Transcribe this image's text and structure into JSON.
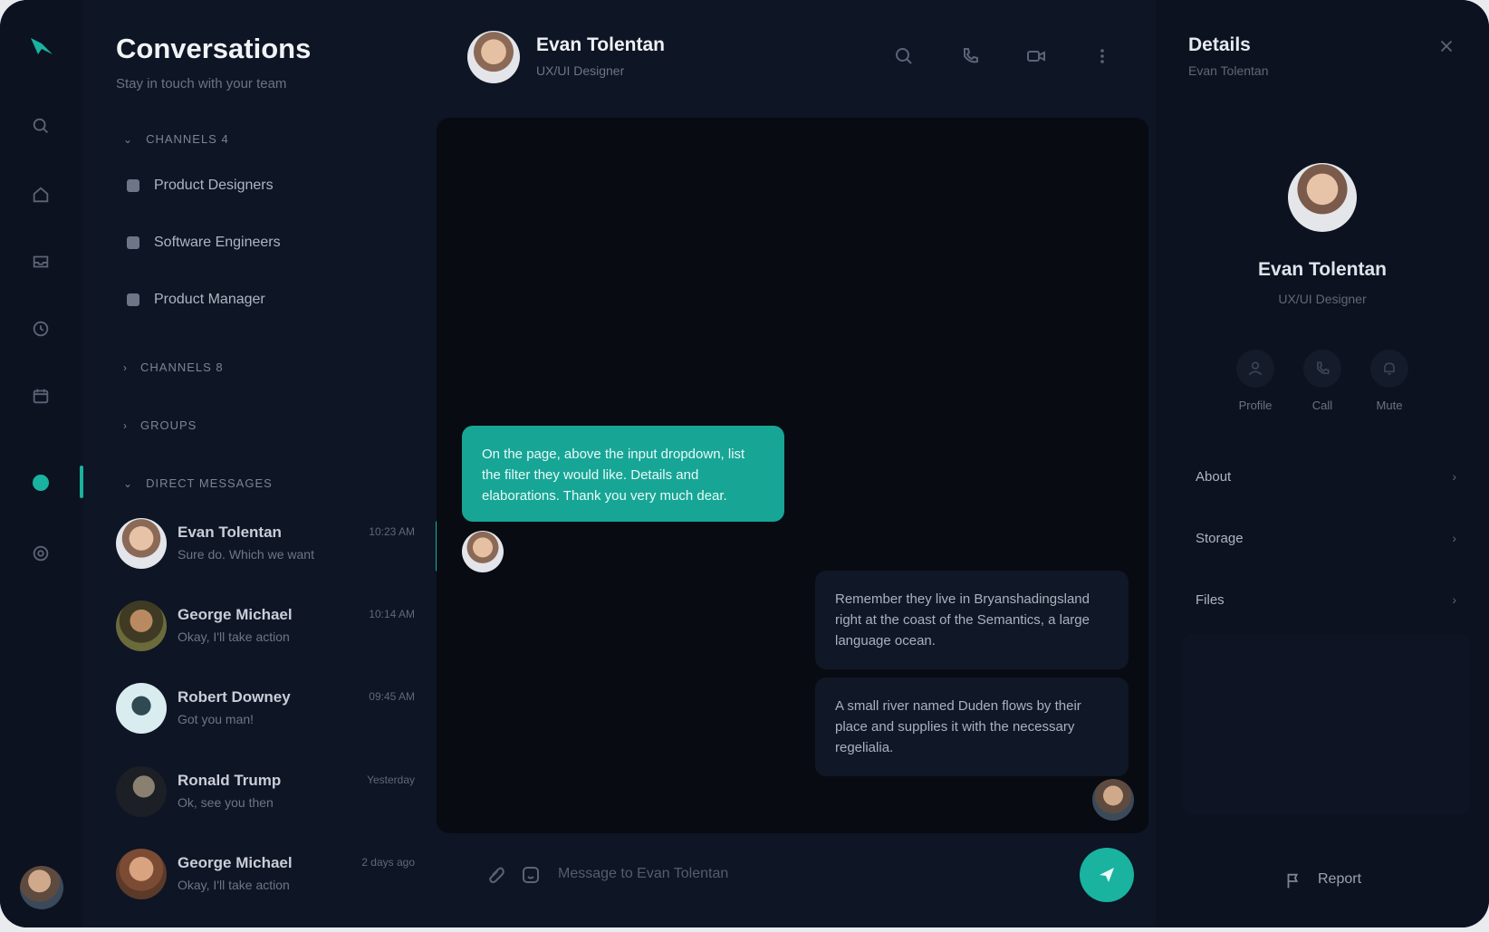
{
  "app": {
    "accent": "#19b3a0",
    "background": "#0d1322"
  },
  "rail": {
    "items": [
      {
        "icon": "search-icon"
      },
      {
        "icon": "home-icon"
      },
      {
        "icon": "inbox-icon"
      },
      {
        "icon": "clock-icon"
      },
      {
        "icon": "calendar-icon"
      },
      {
        "icon": "chat-icon",
        "active": true
      },
      {
        "icon": "settings-icon"
      }
    ]
  },
  "conversations": {
    "title": "Conversations",
    "subtitle": "Stay in touch with your team",
    "groups": [
      {
        "label": "CHANNELS 4",
        "channels": [
          "Product Designers",
          "Software Engineers",
          "Product Manager"
        ]
      },
      {
        "label": "CHANNELS 8",
        "channels": []
      },
      {
        "label": "GROUPS",
        "channels": []
      },
      {
        "label": "DIRECT MESSAGES",
        "channels": []
      }
    ],
    "direct_messages": [
      {
        "name": "Evan Tolentan",
        "preview": "Sure do. Which we want",
        "time": "10:23 AM",
        "active": true
      },
      {
        "name": "George Michael",
        "preview": "Okay, I'll take action",
        "time": "10:14 AM"
      },
      {
        "name": "Robert Downey",
        "preview": "Got you man!",
        "time": "09:45 AM"
      },
      {
        "name": "Ronald Trump",
        "preview": "Ok, see you then",
        "time": "Yesterday"
      },
      {
        "name": "George Michael",
        "preview": "Okay, I'll take action",
        "time": "2 days ago"
      }
    ]
  },
  "chat": {
    "contact_name": "Evan Tolentan",
    "contact_role": "UX/UI Designer",
    "header_icons": [
      "search-icon",
      "phone-icon",
      "video-icon",
      "more-vertical-icon"
    ],
    "messages": [
      {
        "direction": "out",
        "text": "On the page, above the input dropdown, list the filter they would like. Details and elaborations. Thank you very much dear."
      },
      {
        "direction": "in",
        "text": "Remember they live in Bryanshadingsland right at the coast of the Semantics, a large language ocean."
      },
      {
        "direction": "in",
        "text": "A small river named Duden flows by their place and supplies it with the necessary regelialia."
      }
    ],
    "composer_placeholder": "Message to Evan Tolentan"
  },
  "details": {
    "title": "Details",
    "subtitle": "Evan Tolentan",
    "profile_name": "Evan Tolentan",
    "profile_role": "UX/UI Designer",
    "quick_actions": [
      {
        "label": "Profile",
        "icon": "user-icon"
      },
      {
        "label": "Call",
        "icon": "phone-icon"
      },
      {
        "label": "Mute",
        "icon": "bell-icon"
      }
    ],
    "sections": [
      "About",
      "Storage",
      "Files"
    ],
    "report_label": "Report"
  }
}
